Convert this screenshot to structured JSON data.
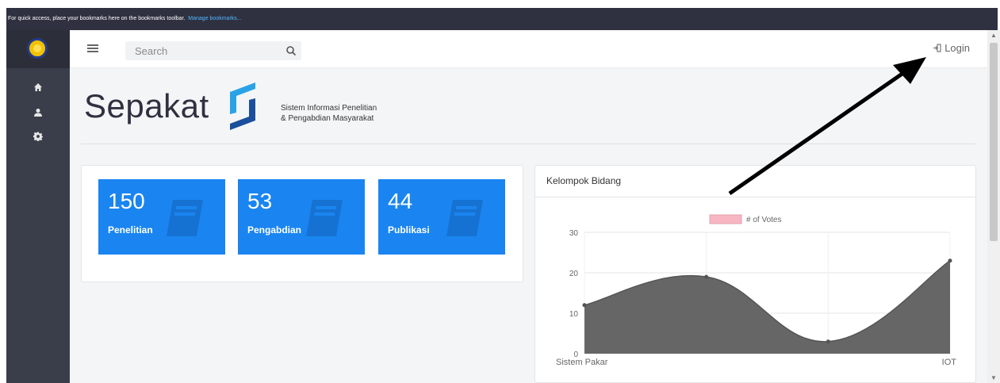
{
  "bookmarks_bar": {
    "message": "For quick access, place your bookmarks here on the bookmarks toolbar.",
    "manage_link": "Manage bookmarks..."
  },
  "topbar": {
    "search_placeholder": "Search",
    "login_label": "Login"
  },
  "brand": {
    "name": "Sepakat",
    "tagline_line1": "Sistem Informasi Penelitian",
    "tagline_line2": "& Pengabdian Masyarakat"
  },
  "stats": [
    {
      "value": "150",
      "label": "Penelitian"
    },
    {
      "value": "53",
      "label": "Pengabdian"
    },
    {
      "value": "44",
      "label": "Publikasi"
    }
  ],
  "chart_data": {
    "type": "area",
    "title": "Kelompok Bidang",
    "categories": [
      "Sistem Pakar",
      "",
      "",
      "IOT"
    ],
    "series": [
      {
        "name": "# of Votes",
        "values": [
          12,
          19,
          3,
          23
        ]
      }
    ],
    "ylim": [
      0,
      30
    ],
    "yticks": [
      "0",
      "10",
      "20",
      "30"
    ],
    "legend_position": "top-center",
    "colors": {
      "fill": "#666666",
      "legend_box": "#f7b6c2",
      "grid": "#e6e6e6"
    }
  },
  "colors": {
    "sidebar": "#3a3e4a",
    "stat_tile": "#1a85f0",
    "annotation_arrow": "#000000"
  }
}
